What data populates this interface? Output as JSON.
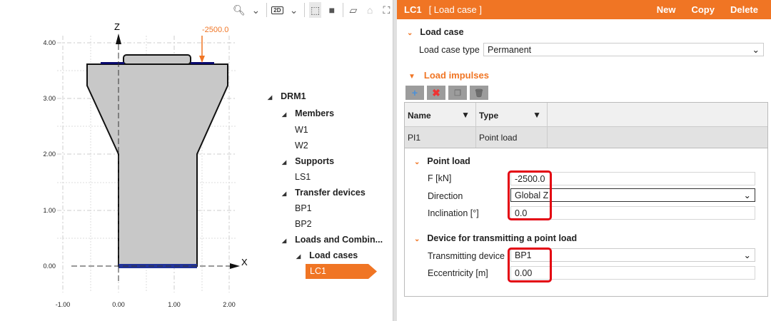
{
  "toolbar": {
    "view_mode": "2D"
  },
  "header": {
    "id": "LC1",
    "subtitle": "[ Load case ]",
    "new": "New",
    "copy": "Copy",
    "delete": "Delete"
  },
  "load_case": {
    "title": "Load case",
    "type_label": "Load case type",
    "type_value": "Permanent"
  },
  "impulses": {
    "title": "Load impulses",
    "columns": [
      "Name",
      "Type"
    ],
    "rows": [
      {
        "name": "PI1",
        "type": "Point load"
      }
    ]
  },
  "point_load": {
    "title": "Point load",
    "f_label": "F [kN]",
    "f_value": "-2500.0",
    "dir_label": "Direction",
    "dir_value": "Global Z",
    "incl_label": "Inclination [°]",
    "incl_value": "0.0"
  },
  "device": {
    "title": "Device for transmitting a point load",
    "dev_label": "Transmitting device",
    "dev_value": "BP1",
    "ecc_label": "Eccentricity [m]",
    "ecc_value": "0.00"
  },
  "tree": {
    "root": "DRM1",
    "members": "Members",
    "w1": "W1",
    "w2": "W2",
    "supports": "Supports",
    "ls1": "LS1",
    "transfer": "Transfer devices",
    "bp1": "BP1",
    "bp2": "BP2",
    "loads": "Loads and Combin...",
    "load_cases": "Load cases",
    "lc1": "LC1"
  },
  "drawing": {
    "x_ticks": [
      "-1.00",
      "0.00",
      "1.00",
      "2.00"
    ],
    "y_ticks": [
      "0.00",
      "1.00",
      "2.00",
      "3.00",
      "4.00"
    ],
    "x_axis": "X",
    "z_axis": "Z",
    "load_value": "-2500.0",
    "accent": "#f07524"
  }
}
